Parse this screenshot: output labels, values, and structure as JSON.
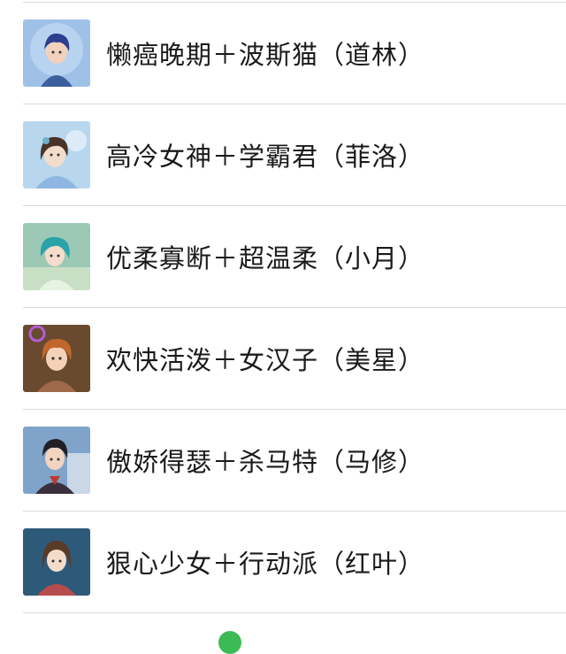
{
  "contacts": [
    {
      "name": "懒癌晚期＋波斯猫（道林）",
      "avatar_icon": "avatar-blue-hair-boy",
      "avatar_bg": "#9fc1e8"
    },
    {
      "name": "高冷女神＋学霸君（菲洛）",
      "avatar_icon": "avatar-girl-flowers",
      "avatar_bg": "#b8d7ee"
    },
    {
      "name": "优柔寡断＋超温柔（小月）",
      "avatar_icon": "avatar-teal-hair-girl",
      "avatar_bg": "#9cc9b6"
    },
    {
      "name": "欢快活泼＋女汉子（美星）",
      "avatar_icon": "avatar-orange-hair-girl",
      "avatar_bg": "#6a4a2e"
    },
    {
      "name": "傲娇得瑟＋杀马特（马修）",
      "avatar_icon": "avatar-dark-hair-boy",
      "avatar_bg": "#7fa3c9"
    },
    {
      "name": "狠心少女＋行动派（红叶）",
      "avatar_icon": "avatar-brown-hair-girl",
      "avatar_bg": "#2e5a7a"
    }
  ]
}
